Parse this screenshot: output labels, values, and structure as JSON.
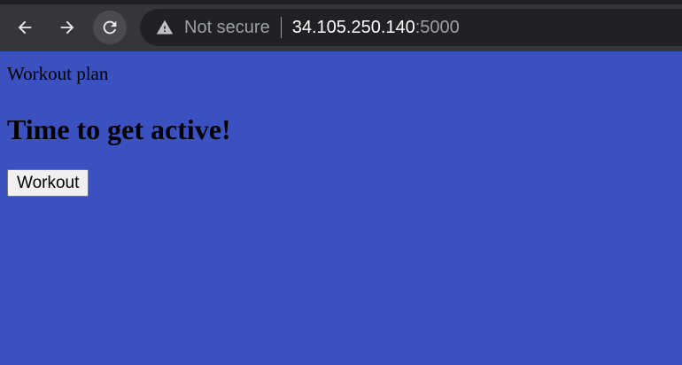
{
  "browser": {
    "security_label": "Not secure",
    "url_host": "34.105.250.140",
    "url_port": ":5000",
    "icons": {
      "back": "arrow-left-icon",
      "forward": "arrow-right-icon",
      "reload": "reload-icon",
      "security": "warning-triangle-icon"
    },
    "colors": {
      "toolbar": "#35363a",
      "omnibox": "#202124"
    }
  },
  "page": {
    "background_color": "#3a51bf",
    "title_text": "Workout plan",
    "heading": "Time to get active!",
    "button_label": "Workout"
  }
}
